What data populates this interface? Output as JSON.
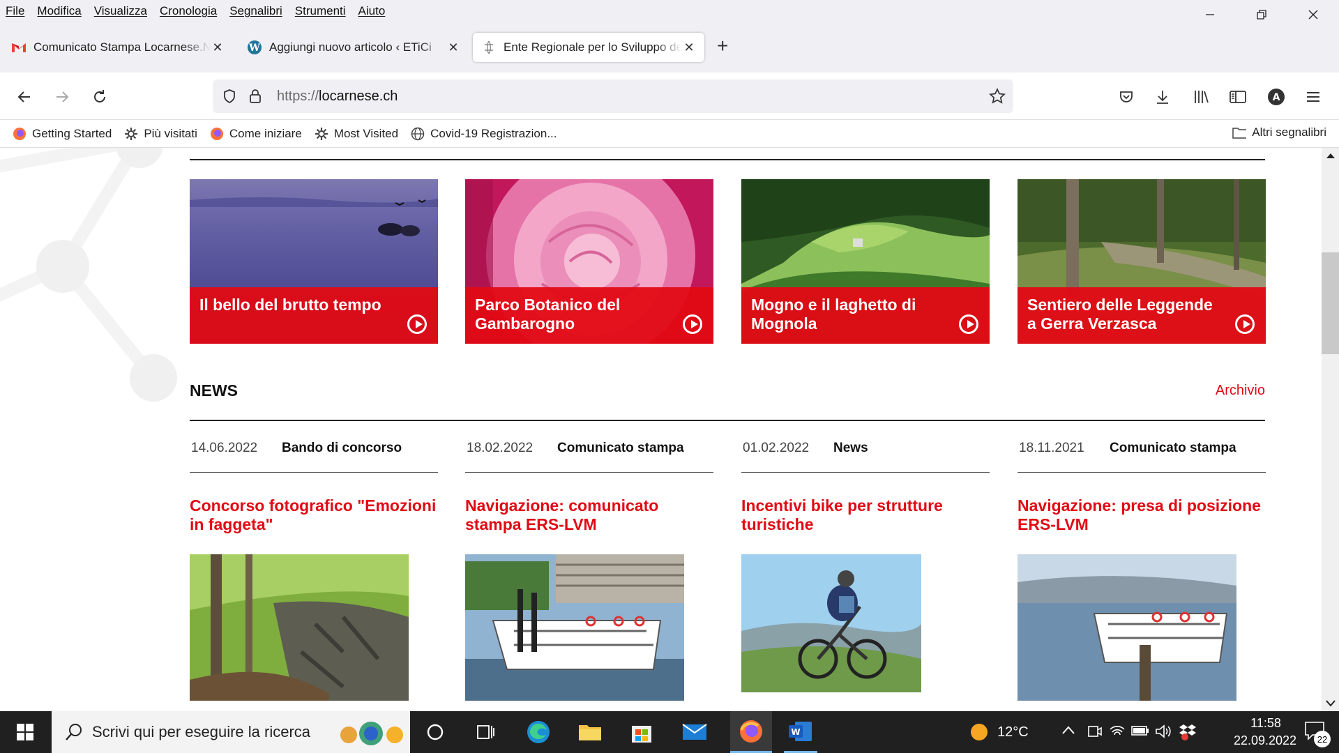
{
  "menubar": {
    "items": [
      "File",
      "Modifica",
      "Visualizza",
      "Cronologia",
      "Segnalibri",
      "Strumenti",
      "Aiuto"
    ]
  },
  "tabs": [
    {
      "title": "Comunicato Stampa Locarnese.Net",
      "icon": "gmail-icon"
    },
    {
      "title": "Aggiungi nuovo articolo ‹ ETiCi",
      "icon": "wordpress-icon"
    },
    {
      "title": "Ente Regionale per lo Sviluppo del",
      "icon": "site-icon",
      "active": true
    }
  ],
  "urlbar": {
    "protocol": "https://",
    "host": "locarnese.ch"
  },
  "bookmarks": {
    "items": [
      {
        "label": "Getting Started",
        "icon": "firefox-icon"
      },
      {
        "label": "Più visitati",
        "icon": "gear-icon"
      },
      {
        "label": "Come iniziare",
        "icon": "firefox-icon"
      },
      {
        "label": "Most Visited",
        "icon": "gear-icon"
      },
      {
        "label": "Covid-19 Registrazion...",
        "icon": "globe-icon"
      }
    ],
    "other": "Altri segnalibri"
  },
  "cards": [
    {
      "title": "Il bello del brutto tempo"
    },
    {
      "title": "Parco Botanico del Gambarogno"
    },
    {
      "title": "Mogno e il laghetto di Mognola"
    },
    {
      "title": "Sentiero delle Leggende a Gerra Verzasca"
    }
  ],
  "news": {
    "title": "NEWS",
    "archive": "Archivio",
    "items": [
      {
        "date": "14.06.2022",
        "category": "Bando di concorso",
        "title": "Concorso fotografico \"Emozioni in faggeta\""
      },
      {
        "date": "18.02.2022",
        "category": "Comunicato stampa",
        "title": "Navigazione: comunicato stampa ERS-LVM"
      },
      {
        "date": "01.02.2022",
        "category": "News",
        "title": "Incentivi bike per strutture turistiche"
      },
      {
        "date": "18.11.2021",
        "category": "Comunicato stampa",
        "title": "Navigazione: presa di posizione ERS-LVM"
      }
    ]
  },
  "taskbar": {
    "search_placeholder": "Scrivi qui per eseguire la ricerca",
    "weather": "12°C",
    "time": "11:58",
    "date": "22.09.2022",
    "notifications": "22"
  },
  "colors": {
    "accent": "#e10a14",
    "chrome": "#f0f0f4",
    "taskbar": "#202020"
  }
}
